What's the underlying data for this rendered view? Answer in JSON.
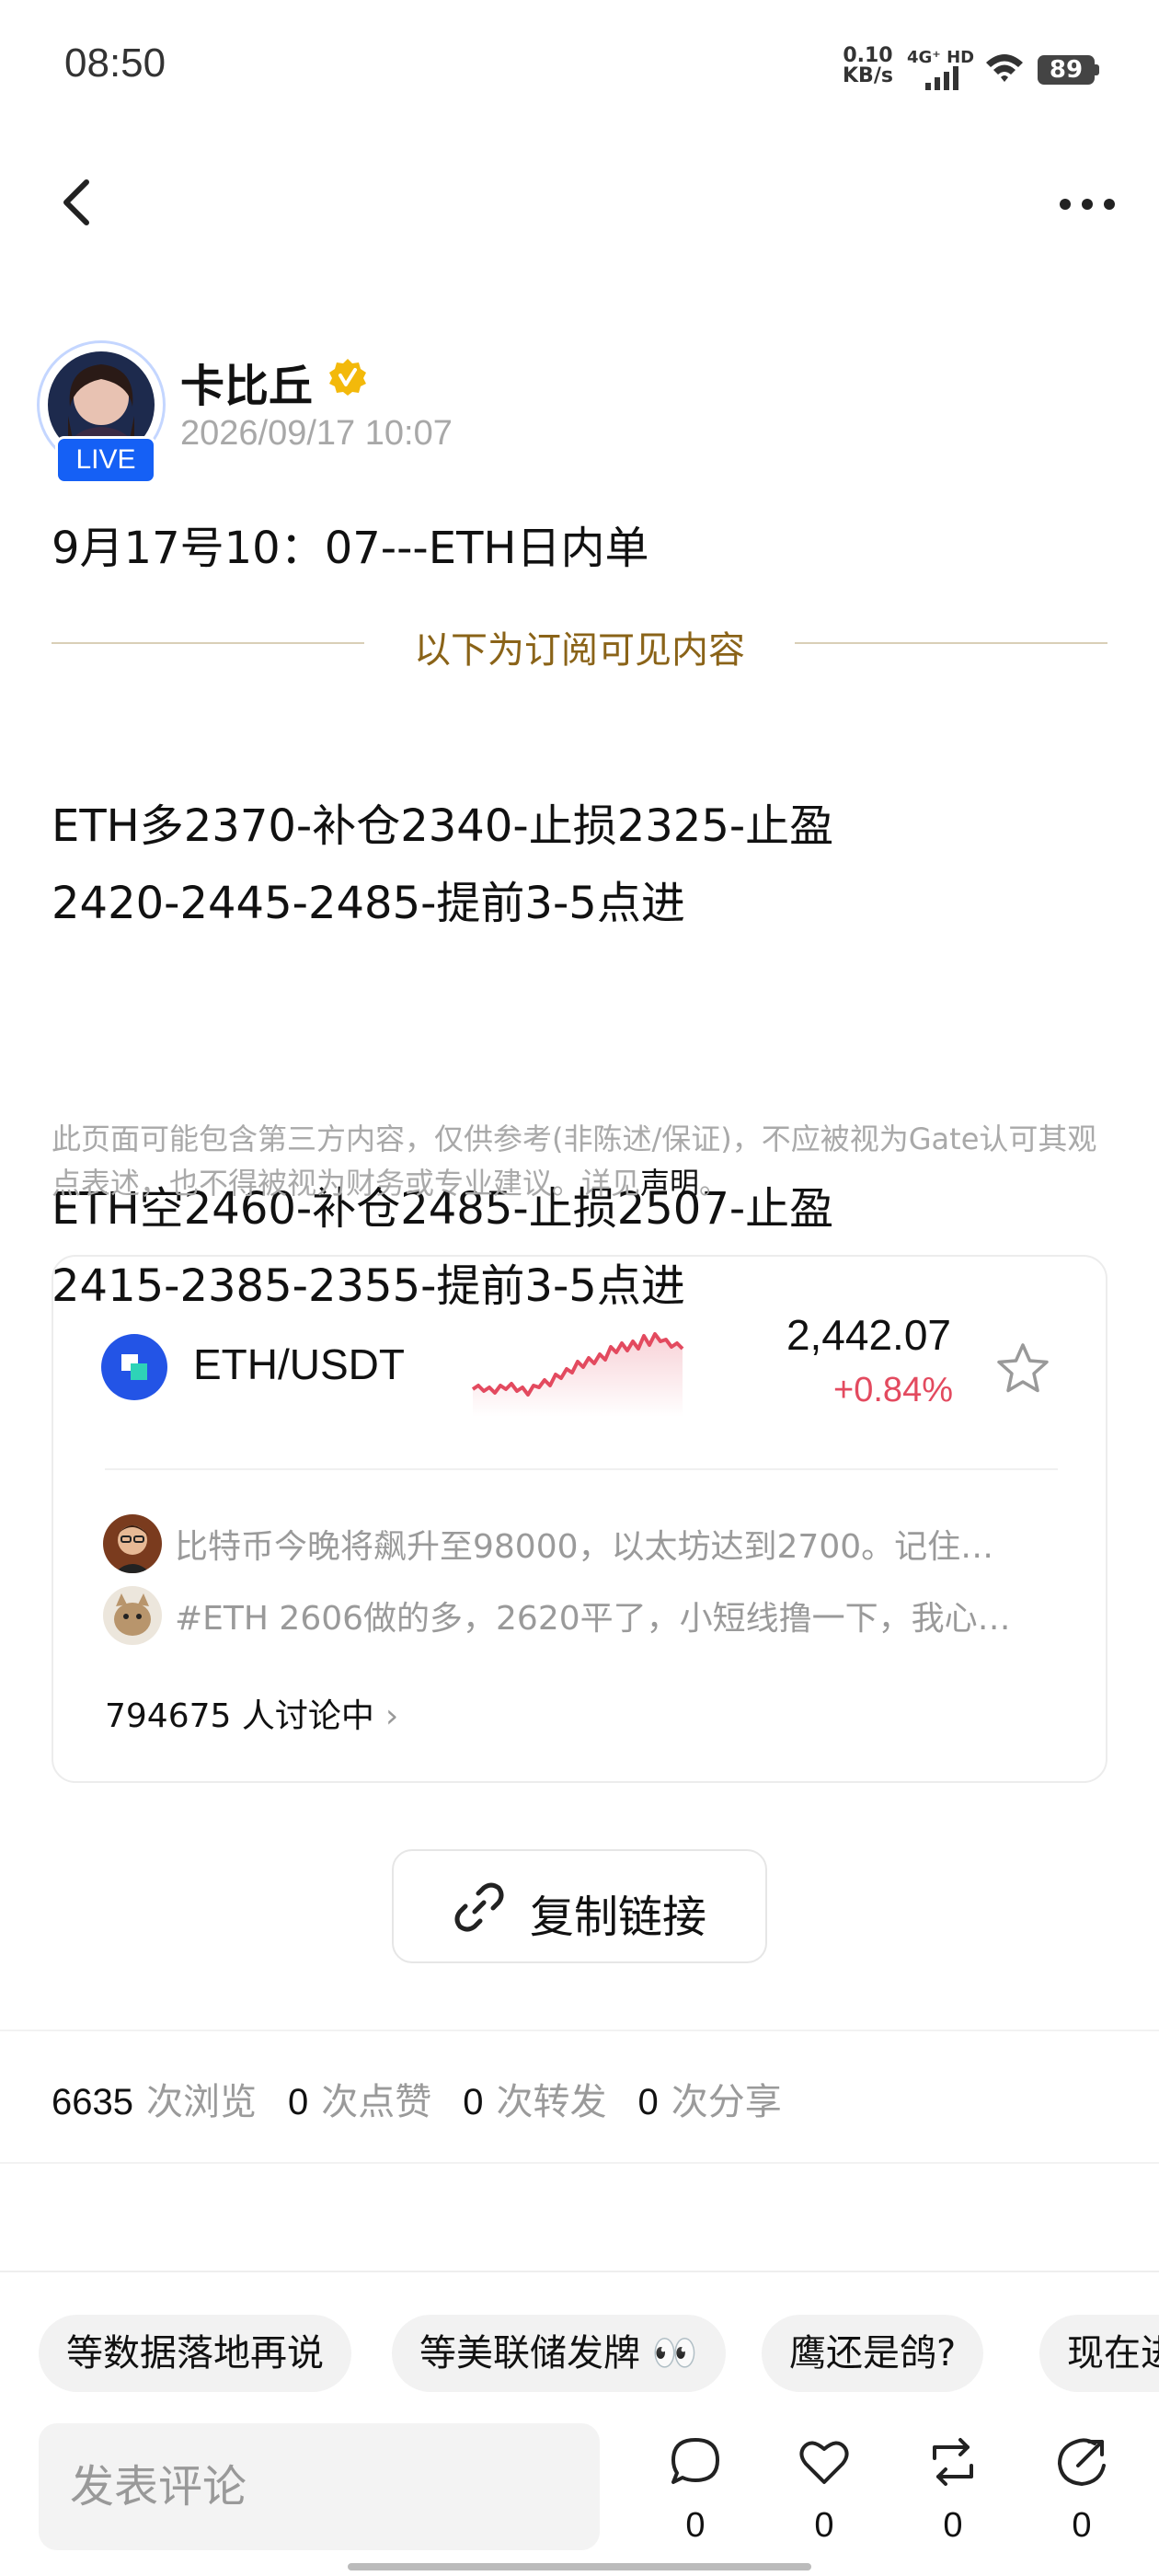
{
  "status_bar": {
    "time": "08:50",
    "net_speed_value": "0.10",
    "net_speed_unit": "KB/s",
    "network": "4G⁺ HD",
    "battery": "89"
  },
  "header": {
    "back_icon": "chevron-left-icon",
    "more_icon": "more-dots-icon"
  },
  "author": {
    "name": "卡比丘",
    "live_badge": "LIVE",
    "verified_icon": "verified-badge-icon",
    "post_time": "2026/09/17 10:07"
  },
  "post": {
    "title": "9月17号10：07---ETH日内单",
    "subscription_label": "以下为订阅可见内容",
    "paragraphs": [
      "ETH多2370-补仓2340-止损2325-止盈\n2420-2445-2485-提前3-5点进",
      "ETH空2460-补仓2485-止损2507-止盈\n2415-2385-2355-提前3-5点进"
    ],
    "disclaimer": "此页面可能包含第三方内容，仅供参考(非陈述/保证)，不应被视为Gate认可其观点表述，也不得被视为财务或专业建议。详见",
    "disclaimer_link": "声明",
    "disclaimer_end": "。"
  },
  "market_card": {
    "pair": "ETH/USDT",
    "price": "2,442.07",
    "change": "+0.84%",
    "change_color": "#e34a5f",
    "star_icon": "star-outline-icon",
    "comments": [
      "比特币今晚将飙升至98000，以太坊达到2700。记住…",
      "#ETH 2606做的多，2620平了，小短线撸一下，我心…"
    ],
    "discussion_count": "794675 人讨论中"
  },
  "copy_link": {
    "label": "复制链接",
    "icon": "link-icon"
  },
  "stats": [
    {
      "value": "6635",
      "label": "次浏览"
    },
    {
      "value": "0",
      "label": "次点赞"
    },
    {
      "value": "0",
      "label": "次转发"
    },
    {
      "value": "0",
      "label": "次分享"
    }
  ],
  "chips": [
    "等数据落地再说",
    "等美联储发牌 👀",
    "鹰还是鸽?",
    "现在进"
  ],
  "bottom_bar": {
    "comment_placeholder": "发表评论",
    "actions": [
      {
        "icon": "comment-icon",
        "count": "0"
      },
      {
        "icon": "heart-icon",
        "count": "0"
      },
      {
        "icon": "repost-icon",
        "count": "0"
      },
      {
        "icon": "share-icon",
        "count": "0"
      }
    ]
  },
  "colors": {
    "accent_blue": "#1560f5",
    "gold": "#8a6318",
    "negative_red": "#e34a5f"
  }
}
